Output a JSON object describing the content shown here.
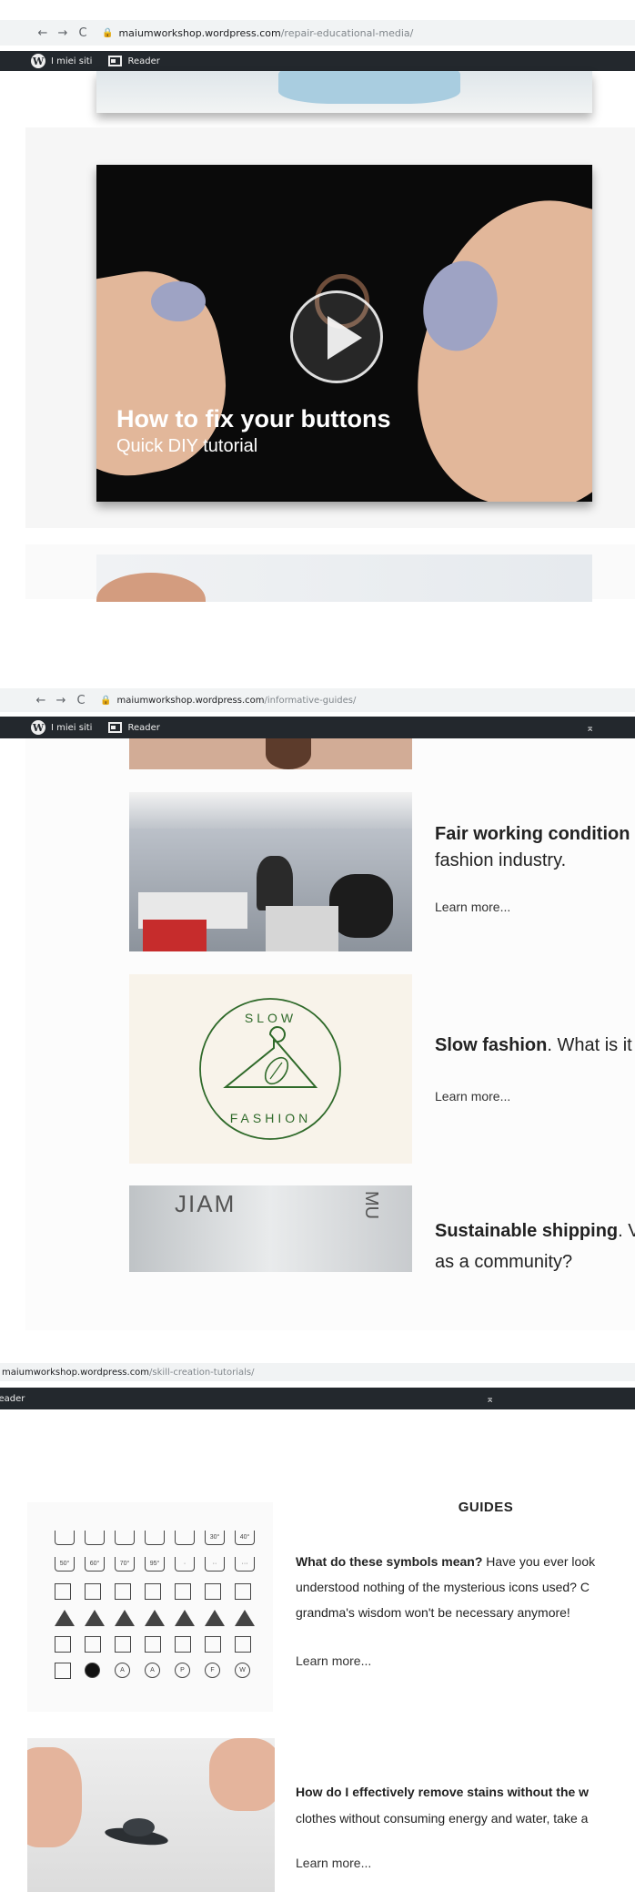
{
  "browser": {
    "back": "←",
    "forward": "→",
    "reload": "C",
    "section1": {
      "domain": "maiumworkshop.wordpress.com",
      "path": "/repair-educational-media/"
    },
    "section2": {
      "domain": "maiumworkshop.wordpress.com",
      "path": "/informative-guides/"
    },
    "section3": {
      "domain": "maiumworkshop.wordpress.com",
      "path": "/skill-creation-tutorials/"
    }
  },
  "adminbar": {
    "my_sites": "I miei siti",
    "reader": "Reader",
    "reader_partial": "Reader",
    "wp_logo": "W",
    "up_arrow": "⌅"
  },
  "video": {
    "title": "How to fix your buttons",
    "subtitle": "Quick DIY tutorial"
  },
  "guides": [
    {
      "bold": "Fair working condition",
      "rest": "",
      "line2": "fashion industry.",
      "learn": "Learn more..."
    },
    {
      "bold": "Slow fashion",
      "rest": ". What is it",
      "line2": "",
      "learn": "Learn more..."
    },
    {
      "bold": "Sustainable shipping",
      "rest": ". V",
      "line2": "as a community?",
      "learn": ""
    }
  ],
  "slow_fashion_logo": {
    "top": "SLOW",
    "bottom": "FASHION",
    "color": "#2f6a2a"
  },
  "section3": {
    "heading": "GUIDES",
    "item1": {
      "bold": "What do these symbols mean?",
      "rest": " Have you ever look",
      "line2": "understood nothing of the mysterious icons used? C",
      "line3": "grandma's wisdom won't be necessary anymore!",
      "learn": "Learn more..."
    },
    "item2": {
      "bold": "How do I effectively remove stains without the w",
      "line2": "clothes without consuming energy and water, take a",
      "learn": "Learn more..."
    },
    "symbols": [
      "",
      "",
      "",
      "",
      "",
      "30°",
      "40°",
      "50°",
      "60°",
      "70°",
      "95°",
      "·",
      "··",
      "···",
      "",
      "",
      "",
      "",
      "",
      "",
      "",
      "",
      "",
      "",
      "",
      "",
      "",
      "",
      "",
      "",
      "",
      "",
      "",
      "",
      "",
      "",
      "",
      "A",
      "A",
      "P",
      "F",
      "W"
    ]
  },
  "colors": {
    "adminbar": "#23282d",
    "urlbar": "#f1f3f4",
    "accent_green": "#2f6a2a"
  }
}
